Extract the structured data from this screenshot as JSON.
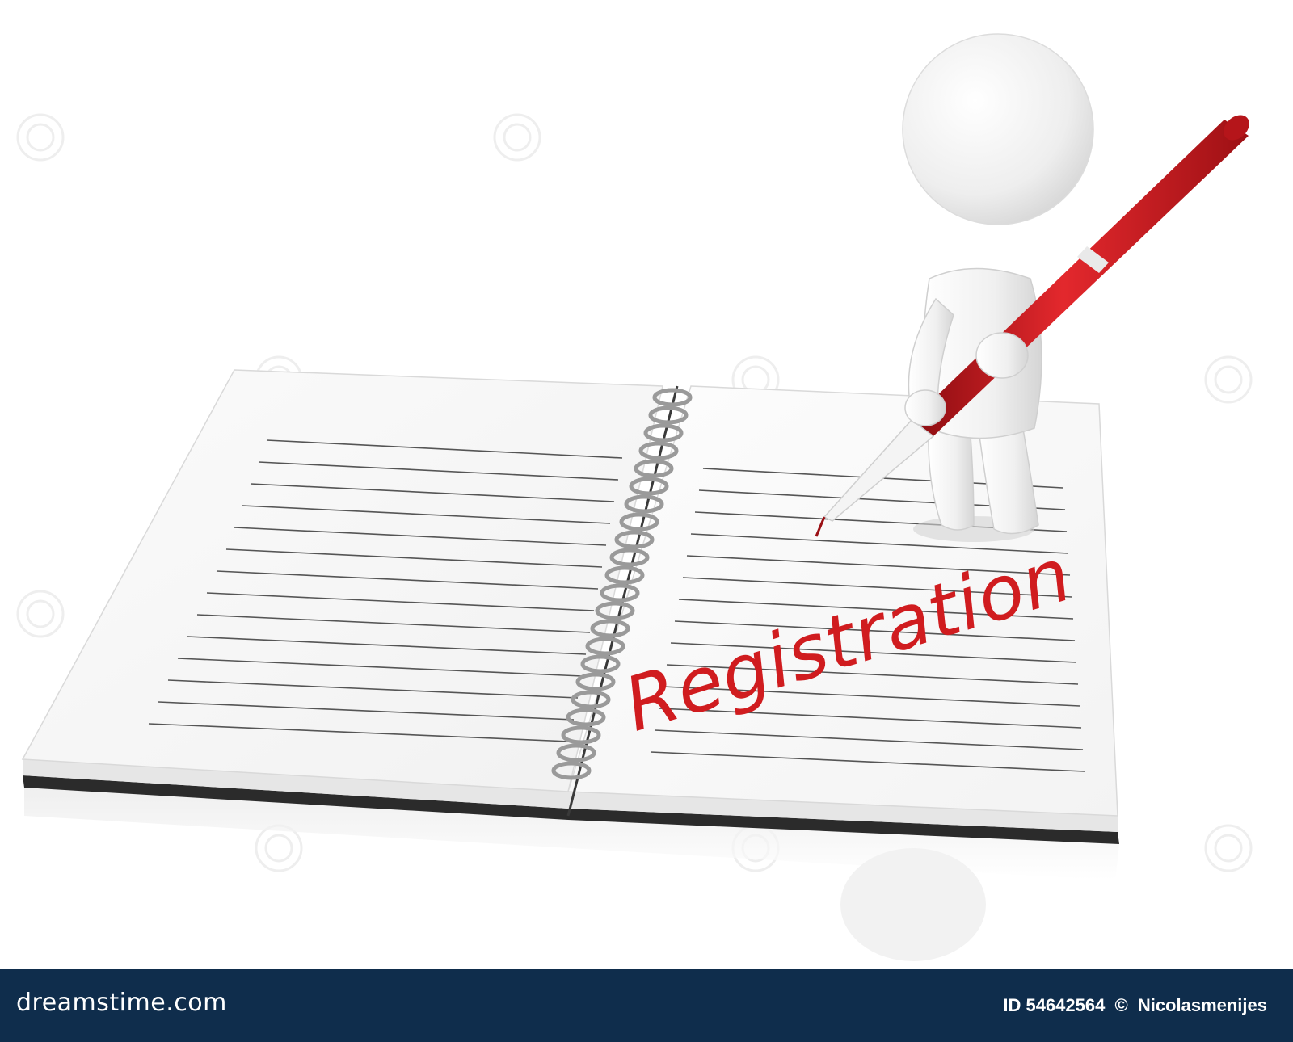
{
  "image": {
    "handwritten_word": "Registration",
    "handwriting_color": "#d01c1f",
    "pen_color": "#c8161b",
    "background_color": "#ffffff"
  },
  "watermark": {
    "text": "dreamstime"
  },
  "footer": {
    "brand": "dreamstime.com",
    "id_label": "ID 54642564",
    "copyright_symbol": "©",
    "author": "Nicolasmenijes",
    "background_color": "#0f2d4c"
  }
}
